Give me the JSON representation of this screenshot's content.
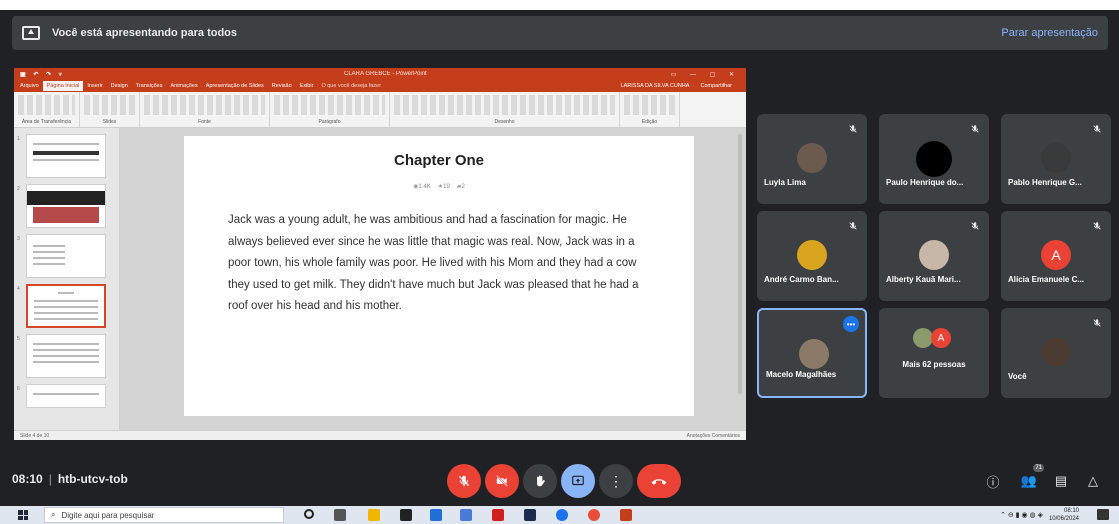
{
  "banner": {
    "text": "Você está apresentando para todos",
    "stop_label": "Parar apresentação"
  },
  "presentation": {
    "app": {
      "doc_title": "CLARA GREBCE - PowerPoint",
      "user": "LARISSA DA SILVA CUNHA",
      "share": "Compartilhar",
      "tabs": [
        "Arquivo",
        "Página Inicial",
        "Inserir",
        "Design",
        "Transições",
        "Animações",
        "Apresentação de Slides",
        "Revisão",
        "Exibir",
        "O que você deseja fazer"
      ],
      "ribbon_groups": [
        "Área de Transferência",
        "Slides",
        "Fonte",
        "Parágrafo",
        "Desenho",
        "Edição"
      ],
      "status_left": "Slide 4 de 10",
      "status_right": "Anotações  Comentários"
    },
    "slide": {
      "title": "Chapter One",
      "stats": {
        "views": "1.4K",
        "stars": "19",
        "comments": "2"
      },
      "text": "Jack was a young adult, he was ambitious and had a fascination for magic. He always believed ever since he was little that magic was real. Now, Jack was in a poor town, his whole family was poor. He lived with his Mom and they had a cow they used to get milk. They didn't have much but Jack was pleased that he had a roof over his head and his mother."
    },
    "thumb_numbers": [
      "1",
      "2",
      "3",
      "4",
      "5",
      "6"
    ]
  },
  "participants": [
    {
      "name": "Luyla Lima",
      "avatar": "photo",
      "color": "#6b5b4e"
    },
    {
      "name": "Paulo Henrique do...",
      "avatar": "photo",
      "color": "#000000"
    },
    {
      "name": "Pablo Henrique G...",
      "avatar": "photo",
      "color": "#3a3a3a"
    },
    {
      "name": "André Carmo Ban...",
      "avatar": "photo",
      "color": "#d9a520"
    },
    {
      "name": "Alberty Kauã Mari...",
      "avatar": "photo",
      "color": "#c7b7a8"
    },
    {
      "name": "Alícia Emanuele C...",
      "avatar": "letter",
      "letter": "A",
      "color": "#ea4335"
    },
    {
      "name": "Macelo Magalhães",
      "avatar": "photo",
      "color": "#8c7a68"
    },
    {
      "name": "Mais 62 pessoas",
      "avatar": "group",
      "letter": "A",
      "color": "#ea4335"
    },
    {
      "name": "Você",
      "avatar": "photo",
      "color": "#4a3b33"
    }
  ],
  "meeting": {
    "time": "08:10",
    "code": "htb-utcv-tob",
    "participants_count": "71"
  },
  "taskbar": {
    "search_placeholder": "Digite aqui para pesquisar",
    "time": "08:10",
    "date": "10/06/2024"
  },
  "colors": {
    "accent": "#8ab4f8",
    "danger": "#ea4335",
    "ppt": "#c43e1c",
    "tile": "#3c4043",
    "bg": "#202124"
  }
}
